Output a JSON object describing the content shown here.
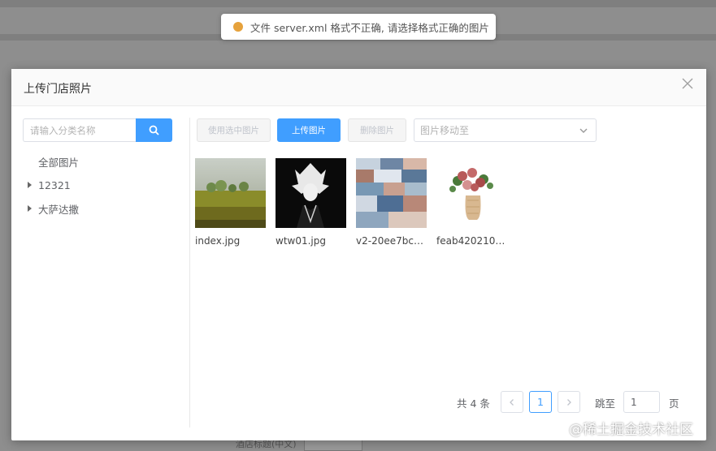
{
  "toast": {
    "message": "文件 server.xml 格式不正确, 请选择格式正确的图片",
    "color": "#e6a23c"
  },
  "dialog": {
    "title": "上传门店照片",
    "close_icon": "close-icon"
  },
  "sidebar": {
    "search_placeholder": "请输入分类名称",
    "search_value": "",
    "tree": [
      {
        "label": "全部图片",
        "expandable": false
      },
      {
        "label": "12321",
        "expandable": true
      },
      {
        "label": "大萨达撒",
        "expandable": true
      }
    ]
  },
  "toolbar": {
    "use_selected": "使用选中图片",
    "upload": "上传图片",
    "delete": "删除图片",
    "move_placeholder": "图片移动至"
  },
  "images": [
    {
      "name": "index.jpg",
      "picture": "landscape-field"
    },
    {
      "name": "wtw01.jpg",
      "picture": "anime-character"
    },
    {
      "name": "v2-20ee7bc9…",
      "picture": "photo-collage"
    },
    {
      "name": "feab4202109…",
      "picture": "flower-vase"
    }
  ],
  "pagination": {
    "total": "共 4 条",
    "current": "1",
    "jump_label": "跳至",
    "jump_value": "1",
    "unit": "页"
  },
  "background": {
    "label": "酒店标题(中文)"
  },
  "watermark": "@稀土掘金技术社区",
  "colors": {
    "primary": "#409eff",
    "warning": "#e6a23c"
  }
}
